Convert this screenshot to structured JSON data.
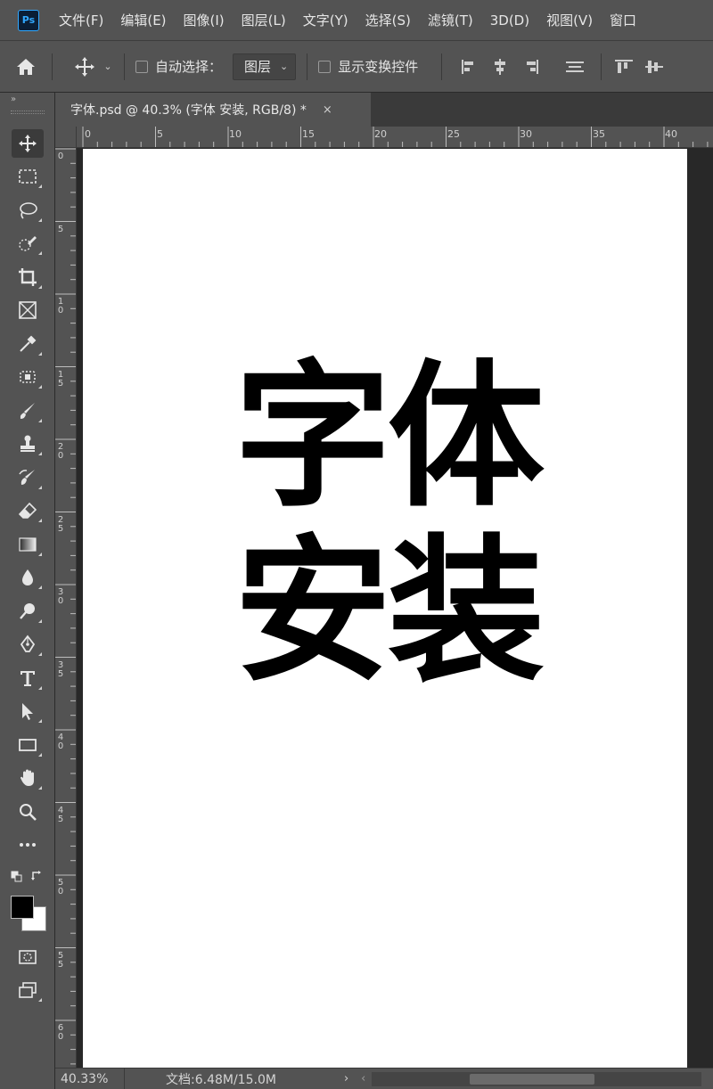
{
  "app": {
    "logo_text": "Ps"
  },
  "menu": [
    "文件(F)",
    "编辑(E)",
    "图像(I)",
    "图层(L)",
    "文字(Y)",
    "选择(S)",
    "滤镜(T)",
    "3D(D)",
    "视图(V)",
    "窗口"
  ],
  "options": {
    "auto_select_label": "自动选择：",
    "auto_select_dropdown": "图层",
    "show_transform_label": "显示变换控件"
  },
  "document": {
    "tab_title": "字体.psd @ 40.3% (字体 安装, RGB/8) *",
    "close_glyph": "×",
    "artwork_line1": "字体",
    "artwork_line2": "安装"
  },
  "rulers": {
    "horizontal": [
      "0",
      "5",
      "10",
      "15",
      "20",
      "25",
      "30",
      "35",
      "40"
    ],
    "vertical": [
      "0",
      "5",
      "10",
      "15",
      "20",
      "25",
      "30",
      "35",
      "40",
      "45",
      "50",
      "55",
      "60"
    ]
  },
  "status": {
    "zoom": "40.33%",
    "doc_size": "文档:6.48M/15.0M",
    "arrow": "›",
    "scroll_left": "‹"
  },
  "tools": [
    "move-tool-icon",
    "marquee-tool-icon",
    "lasso-tool-icon",
    "quick-selection-tool-icon",
    "crop-tool-icon",
    "frame-tool-icon",
    "eyedropper-tool-icon",
    "spot-healing-tool-icon",
    "brush-tool-icon",
    "clone-stamp-tool-icon",
    "history-brush-tool-icon",
    "eraser-tool-icon",
    "gradient-tool-icon",
    "blur-tool-icon",
    "dodge-tool-icon",
    "pen-tool-icon",
    "type-tool-icon",
    "path-selection-tool-icon",
    "rectangle-tool-icon",
    "hand-tool-icon",
    "zoom-tool-icon",
    "more-tools-icon"
  ],
  "colors": {
    "foreground": "#000000",
    "background": "#ffffff",
    "accent": "#31a8ff"
  }
}
